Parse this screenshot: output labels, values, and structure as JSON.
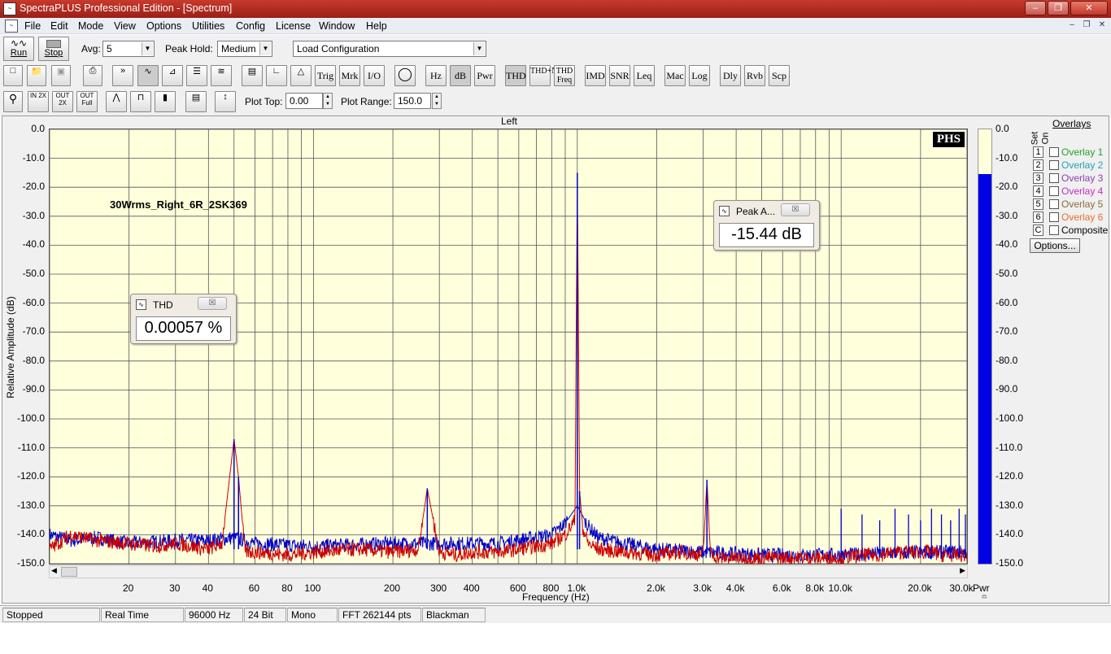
{
  "window": {
    "title": "SpectraPLUS Professional Edition - [Spectrum]",
    "app_icon": "spectraplus-icon"
  },
  "menu": [
    "File",
    "Edit",
    "Mode",
    "View",
    "Options",
    "Utilities",
    "Config",
    "License",
    "Window",
    "Help"
  ],
  "toolbar1": {
    "run_label": "Run",
    "stop_label": "Stop",
    "avg_label": "Avg:",
    "avg_value": "5",
    "peak_hold_label": "Peak Hold:",
    "peak_hold_value": "Medium",
    "config_value": "Load Configuration"
  },
  "toolbar2": {
    "buttons": [
      "Trig",
      "Mrk",
      "I/O",
      "Hz",
      "dB",
      "Pwr",
      "THD",
      "THD+N",
      "THD Freq",
      "IMD",
      "SNR",
      "Leq",
      "Mac",
      "Log",
      "Dly",
      "Rvb",
      "Scp"
    ]
  },
  "toolbar3": {
    "plot_top_label": "Plot Top:",
    "plot_top_value": "0.00",
    "plot_range_label": "Plot Range:",
    "plot_range_value": "150.0"
  },
  "plot": {
    "channel_title": "Left",
    "annotation": "30Wrms_Right_6R_2SK369",
    "logo": "PHS",
    "y_axis_label": "Relative Amplitude (dB)",
    "x_axis_label": "Frequency (Hz)",
    "y_ticks": [
      "0.0",
      "-10.0",
      "-20.0",
      "-30.0",
      "-40.0",
      "-50.0",
      "-60.0",
      "-70.0",
      "-80.0",
      "-90.0",
      "-100.0",
      "-110.0",
      "-120.0",
      "-130.0",
      "-140.0",
      "-150.0"
    ],
    "x_ticks": [
      "20",
      "30",
      "40",
      "60",
      "80",
      "100",
      "200",
      "300",
      "400",
      "600",
      "800",
      "1.0k",
      "2.0k",
      "3.0k",
      "4.0k",
      "6.0k",
      "8.0k",
      "10.0k",
      "20.0k",
      "30.0k"
    ],
    "pwr_label": "Pwr",
    "colors": {
      "plot_bg": "#ffffdc",
      "trace1": "#0000c8",
      "trace2": "#cc0000",
      "pwr_bar": "#0000e6"
    }
  },
  "chart_data": {
    "type": "line",
    "title": "Left",
    "xlabel": "Frequency (Hz)",
    "ylabel": "Relative Amplitude (dB)",
    "x_scale": "log",
    "xlim": [
      10,
      30000
    ],
    "ylim": [
      -150,
      0
    ],
    "series": [
      {
        "values_x": [
          10,
          12,
          15,
          20,
          25,
          30,
          40,
          45,
          50,
          52,
          55,
          60,
          80,
          100,
          150,
          200,
          250,
          270,
          300,
          350,
          400,
          500,
          600,
          700,
          800,
          900,
          980,
          1000,
          1020,
          1050,
          1100,
          1200,
          1500,
          2000,
          2500,
          3000,
          3100,
          3200,
          3500,
          4000,
          5000,
          6000,
          7000,
          8000,
          9000,
          10000,
          12000,
          14000,
          16000,
          18000,
          20000,
          22000,
          24000,
          26000,
          28000,
          30000
        ],
        "values": [
          -145,
          -140,
          -142,
          -143,
          -144,
          -143,
          -145,
          -143,
          -107,
          -120,
          -146,
          -146,
          -147,
          -146,
          -145,
          -146,
          -145,
          -124,
          -146,
          -147,
          -146,
          -146,
          -145,
          -144,
          -143,
          -140,
          -135,
          -15,
          -125,
          -138,
          -143,
          -145,
          -146,
          -147,
          -146,
          -147,
          -121,
          -147,
          -148,
          -148,
          -148,
          -148,
          -148,
          -148,
          -148,
          -148,
          -147,
          -147,
          -146,
          -146,
          -146,
          -146,
          -147,
          -147,
          -147,
          -147
        ]
      },
      {
        "values_x": [
          10,
          12,
          15,
          20,
          30,
          40,
          50,
          60,
          100,
          200,
          300,
          500,
          800,
          900,
          1000,
          1100,
          1200,
          1500,
          2000,
          3000,
          5000,
          8000,
          10000,
          20000,
          30000
        ],
        "values": [
          -140,
          -142,
          -141,
          -143,
          -142,
          -142,
          -141,
          -143,
          -144,
          -143,
          -143,
          -143,
          -140,
          -136,
          -130,
          -137,
          -141,
          -143,
          -145,
          -146,
          -147,
          -147,
          -147,
          -146,
          -146
        ]
      }
    ],
    "grid": true,
    "power_bar_level_db": -15.44
  },
  "thd_popup": {
    "title": "THD",
    "value": "0.00057 %"
  },
  "peak_popup": {
    "title": "Peak A...",
    "value": "-15.44 dB"
  },
  "overlays": {
    "header": "Overlays",
    "set_label": "Set",
    "on_label": "On",
    "items": [
      {
        "num": "1",
        "name": "Overlay 1",
        "color": "#2a9d2a"
      },
      {
        "num": "2",
        "name": "Overlay 2",
        "color": "#1fa3b5"
      },
      {
        "num": "3",
        "name": "Overlay 3",
        "color": "#8a3fb0"
      },
      {
        "num": "4",
        "name": "Overlay 4",
        "color": "#c030c0"
      },
      {
        "num": "5",
        "name": "Overlay 5",
        "color": "#8a6a3a"
      },
      {
        "num": "6",
        "name": "Overlay 6",
        "color": "#e07030"
      },
      {
        "num": "C",
        "name": "Composite",
        "color": "#000000"
      }
    ],
    "options_label": "Options..."
  },
  "status": [
    "Stopped",
    "Real Time",
    "96000 Hz",
    "24 Bit",
    "Mono",
    "FFT 262144 pts",
    "Blackman"
  ]
}
